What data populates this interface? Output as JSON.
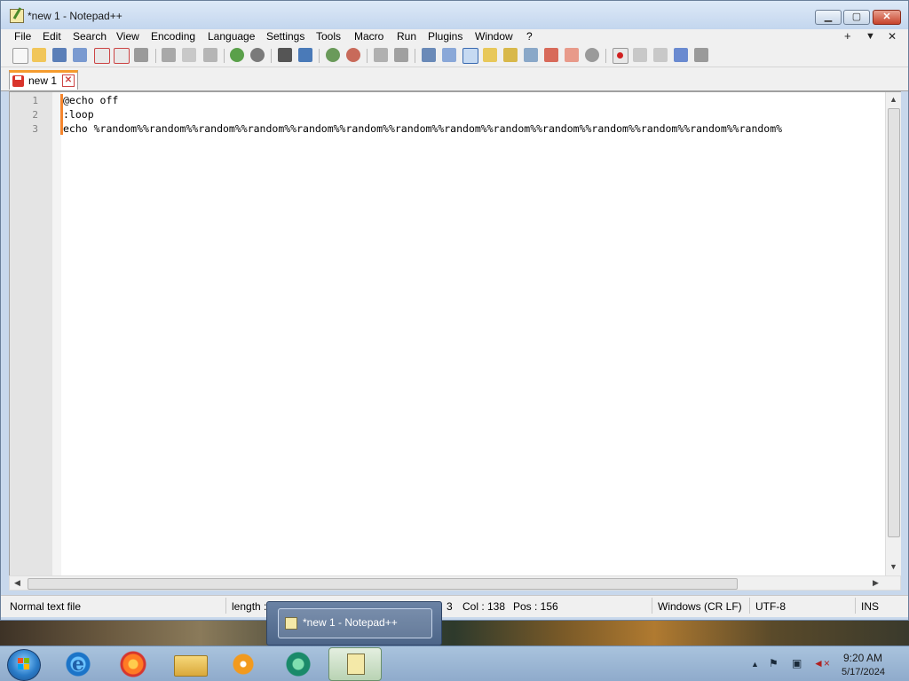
{
  "window": {
    "title": "*new 1 - Notepad++",
    "controls": {
      "minimize": "▁",
      "maximize": "▢",
      "close": "✕"
    }
  },
  "menu": {
    "items": [
      "File",
      "Edit",
      "Search",
      "View",
      "Encoding",
      "Language",
      "Settings",
      "Tools",
      "Macro",
      "Run",
      "Plugins",
      "Window",
      "?"
    ],
    "right": {
      "add": "+",
      "dropdown": "▼",
      "close": "✕"
    }
  },
  "toolbar": {
    "icons": [
      "new-file-icon",
      "open-file-icon",
      "save-icon",
      "save-all-icon",
      "close-icon",
      "close-all-icon",
      "print-icon",
      "cut-icon",
      "copy-icon",
      "paste-icon",
      "undo-icon",
      "redo-icon",
      "find-icon",
      "replace-icon",
      "zoom-in-icon",
      "zoom-out-icon",
      "sync-vertical-icon",
      "sync-horizontal-icon",
      "word-wrap-icon",
      "show-all-chars-icon",
      "indent-guide-icon",
      "define-language-icon",
      "document-map-icon",
      "function-list-icon",
      "folder-workspace-icon",
      "monitoring-icon",
      "record-macro-icon",
      "stop-macro-icon",
      "play-macro-icon",
      "run-macro-multiple-icon",
      "save-macro-icon"
    ]
  },
  "tab": {
    "label": "new 1",
    "close": "✕"
  },
  "editor": {
    "line_numbers": [
      "1",
      "2",
      "3"
    ],
    "lines": [
      "@echo off",
      ":loop",
      "echo %random%%random%%random%%random%%random%%random%%random%%random%%random%%random%%random%%random%%random%%random%"
    ]
  },
  "statusbar": {
    "file_type": "Normal text file",
    "length": "length :",
    "line": "3",
    "col": "Col : 138",
    "pos": "Pos : 156",
    "eol": "Windows (CR LF)",
    "encoding": "UTF-8",
    "mode": "INS"
  },
  "taskbar_preview": {
    "label": "*new 1 - Notepad++"
  },
  "clock": {
    "time": "9:20 AM",
    "date": "5/17/2024"
  },
  "tray": {
    "expand": "▲"
  },
  "colors": {
    "tab_accent": "#f59b2e",
    "modified_marker": "#f5862e",
    "gutter": "#e4e4e4"
  }
}
